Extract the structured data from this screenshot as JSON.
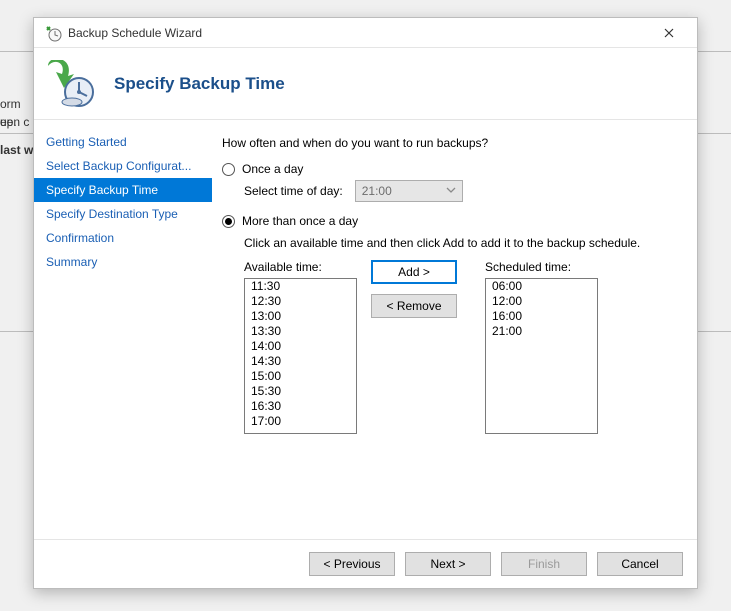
{
  "background": {
    "t1": "orm ",
    "t2": "een c",
    "t3": "last w",
    "t4": "up."
  },
  "title": "Backup Schedule Wizard",
  "heading": "Specify Backup Time",
  "sidebar": {
    "items": [
      {
        "label": "Getting Started"
      },
      {
        "label": "Select Backup Configurat..."
      },
      {
        "label": "Specify Backup Time"
      },
      {
        "label": "Specify Destination Type"
      },
      {
        "label": "Confirmation"
      },
      {
        "label": "Summary"
      }
    ],
    "active_index": 2
  },
  "content": {
    "question": "How often and when do you want to run backups?",
    "once_label": "Once a day",
    "once_sub": "Select time of day:",
    "once_time": "21:00",
    "more_label": "More than once a day",
    "more_instr": "Click an available time and then click Add to add it to the backup schedule.",
    "available_label": "Available time:",
    "scheduled_label": "Scheduled time:",
    "available_times": [
      "11:30",
      "12:30",
      "13:00",
      "13:30",
      "14:00",
      "14:30",
      "15:00",
      "15:30",
      "16:30",
      "17:00"
    ],
    "scheduled_times": [
      "06:00",
      "12:00",
      "16:00",
      "21:00"
    ],
    "add_btn": "Add >",
    "remove_btn": "< Remove"
  },
  "footer": {
    "previous": "< Previous",
    "next": "Next >",
    "finish": "Finish",
    "cancel": "Cancel"
  }
}
